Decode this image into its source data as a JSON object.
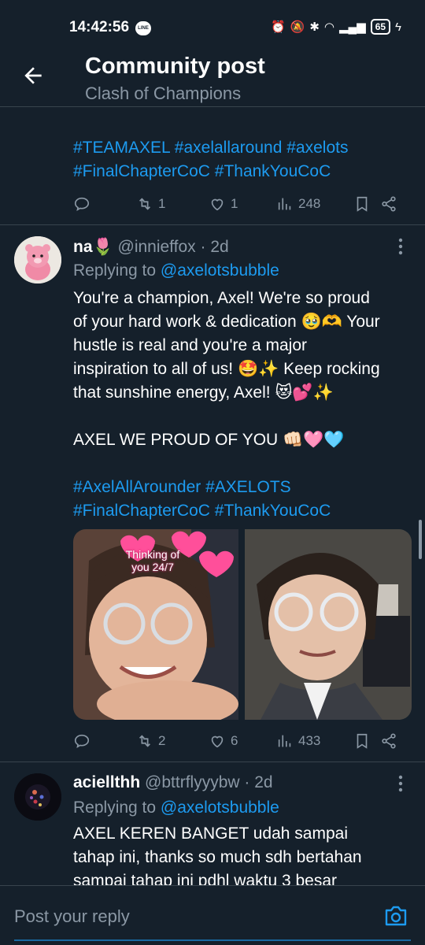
{
  "status_bar": {
    "time": "14:42:56",
    "line_badge": "LINE",
    "battery": "65"
  },
  "header": {
    "title": "Community post",
    "subtitle": "Clash of Champions"
  },
  "tweet_top": {
    "hashtags_line1": [
      "#TEAMAXEL",
      "#axelallaround",
      "#axelots"
    ],
    "hashtags_line2": [
      "#FinalChapterCoC",
      "#ThankYouCoC"
    ],
    "retweets": "1",
    "likes": "1",
    "views": "248"
  },
  "tweet_1": {
    "name": "na🌷",
    "handle": "@innieffox",
    "time": "· 2d",
    "replying_label": "Replying to",
    "replying_handle": "@axelotsbubble",
    "body_lines": [
      "You're a champion, Axel! We're so proud",
      "of your hard work & dedication 🥹🫶 Your",
      "hustle is real and you're a major",
      "inspiration to all of us! 🤩✨ Keep rocking",
      "that sunshine energy, Axel! 😻💕✨"
    ],
    "body_line2": "AXEL WE PROUD OF YOU 👊🏻🩷🩵",
    "hashtags_line1": [
      "#AxelAllArounder",
      "#AXELOTS"
    ],
    "hashtags_line2": [
      "#FinalChapterCoC",
      "#ThankYouCoC"
    ],
    "photo_caption": "Thinking of you 24/7",
    "retweets": "2",
    "likes": "6",
    "views": "433"
  },
  "tweet_2": {
    "name": "aciellthh",
    "handle": "@bttrflyyybw",
    "time": "· 2d",
    "replying_label": "Replying to",
    "replying_handle": "@axelotsbubble",
    "body_lines": [
      "AXEL KEREN BANGET udah sampai",
      "tahap ini, thanks so much sdh bertahan",
      "sampai tahap ini pdhl waktu 3 besar"
    ]
  },
  "composer": {
    "placeholder": "Post your reply"
  },
  "colors": {
    "background": "#15202b",
    "accent": "#1d9bf0",
    "muted": "#8b98a5",
    "divider": "#38444d"
  }
}
